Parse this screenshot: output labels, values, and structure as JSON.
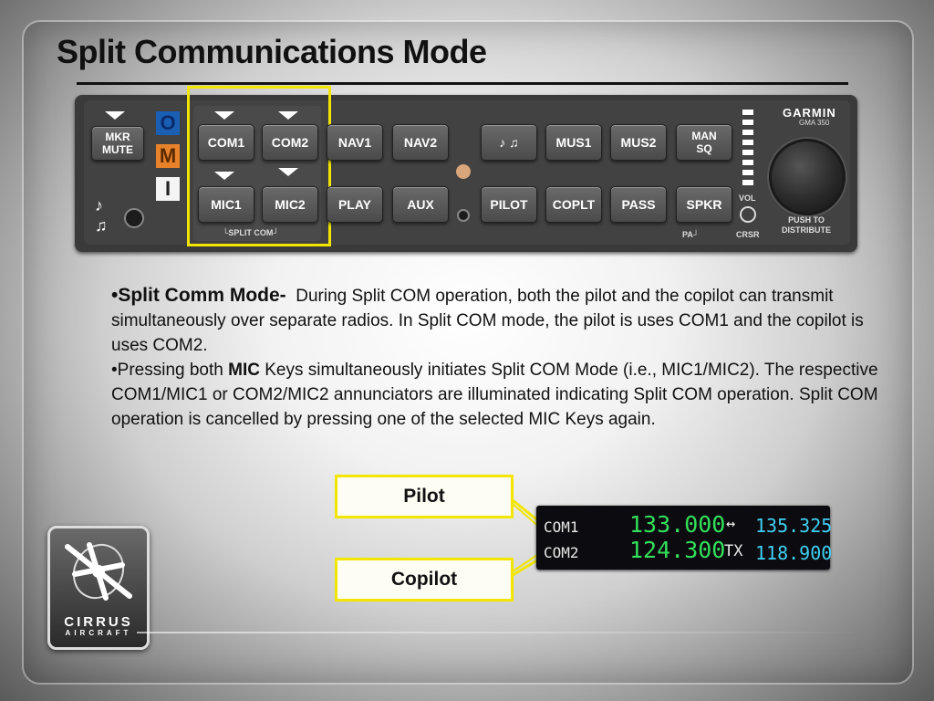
{
  "title": "Split Communications Mode",
  "panel": {
    "brand": "GARMIN",
    "model": "GMA 350",
    "mkr_mute": "MKR\nMUTE",
    "o": "O",
    "m": "M",
    "i": "I",
    "com1": "COM1",
    "com2": "COM2",
    "nav1": "NAV1",
    "nav2": "NAV2",
    "music_icons": "♪ ♫",
    "mus1": "MUS1",
    "mus2": "MUS2",
    "man_sq": "MAN\nSQ",
    "mic1": "MIC1",
    "mic2": "MIC2",
    "play": "PLAY",
    "aux": "AUX",
    "pilot": "PILOT",
    "coplt": "COPLT",
    "pass": "PASS",
    "spkr": "SPKR",
    "split_com": "└SPLIT COM┘",
    "pa": "PA┘",
    "vol": "VOL",
    "crsr": "CRSR",
    "push_to_distribute": "PUSH TO DISTRIBUTE",
    "left_icons": "♪ ♫"
  },
  "body": {
    "p1_lead": "•Split Comm Mode-",
    "p1_text": "During Split COM operation, both the pilot and the copilot can transmit simultaneously over separate radios. In Split COM mode, the pilot is uses COM1 and the copilot is uses COM2.",
    "p2_pre": "•Pressing both ",
    "p2_bold": "MIC",
    "p2_post": " Keys simultaneously initiates Split COM Mode (i.e., MIC1/MIC2). The respective COM1/MIC1 or COM2/MIC2 annunciators are illuminated indicating Split COM operation. Split COM operation is cancelled by pressing one of the selected MIC Keys again."
  },
  "callouts": {
    "pilot": "Pilot",
    "copilot": "Copilot"
  },
  "com_display": {
    "com1_label": "COM1",
    "com1_active": "133.000",
    "com1_indicator": "↔",
    "com1_standby": "135.325",
    "com2_label": "COM2",
    "com2_active": "124.300",
    "com2_indicator": "TX",
    "com2_standby": "118.900"
  },
  "logo": {
    "line1": "CIRRUS",
    "line2": "AIRCRAFT"
  }
}
